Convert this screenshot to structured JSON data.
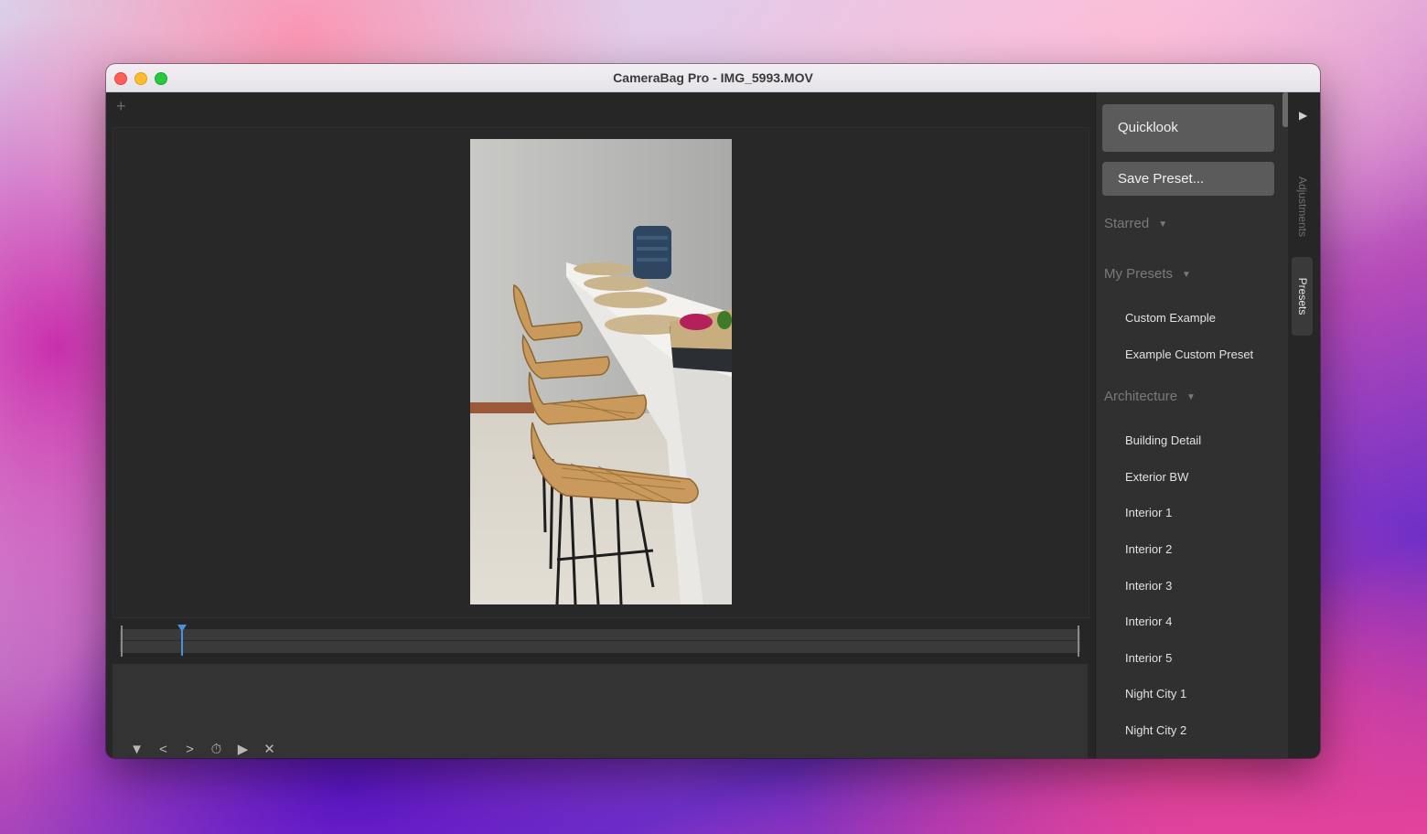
{
  "window": {
    "title": "CameraBag Pro - IMG_5993.MOV"
  },
  "toolbar": {
    "add_icon": "+"
  },
  "playback_controls": [
    "▼",
    "<",
    ">",
    "⏱",
    "▶",
    "✕"
  ],
  "sidebar": {
    "quicklook_label": "Quicklook",
    "save_preset_label": "Save Preset...",
    "sections": {
      "starred": "Starred",
      "my_presets": "My Presets",
      "architecture": "Architecture"
    },
    "my_presets_items": [
      "Custom Example",
      "Example Custom Preset"
    ],
    "architecture_items": [
      "Building Detail",
      "Exterior BW",
      "Interior 1",
      "Interior 2",
      "Interior 3",
      "Interior 4",
      "Interior 5",
      "Night City 1",
      "Night City 2"
    ]
  },
  "tabs": {
    "adjustments": "Adjustments",
    "presets": "Presets"
  },
  "colors": {
    "accent_playhead": "#4a90d9",
    "panel_bg": "#262626",
    "button_bg": "#5b5b5b"
  }
}
